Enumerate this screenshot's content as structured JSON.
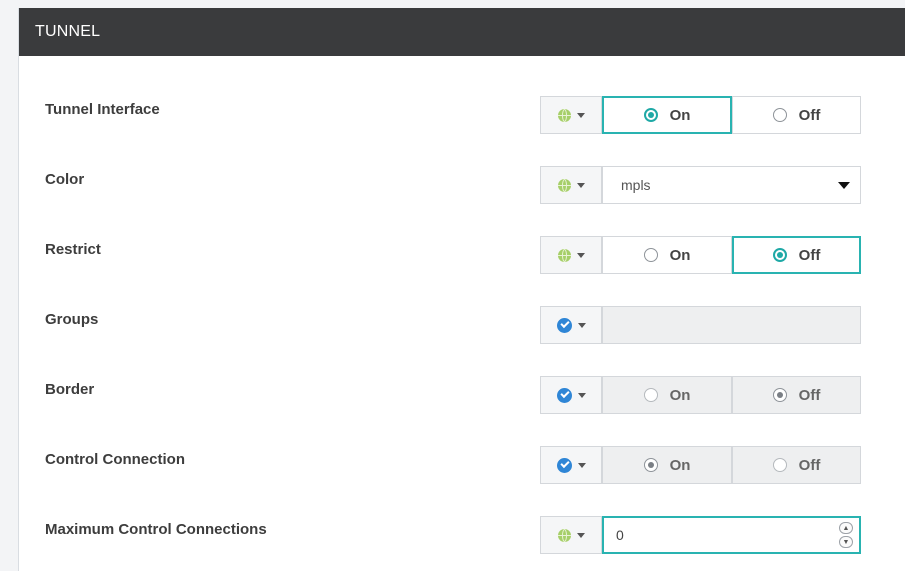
{
  "section": {
    "title": "TUNNEL"
  },
  "fields": {
    "tunnel_interface": {
      "label": "Tunnel Interface",
      "scope_icon": "globe-icon",
      "on_label": "On",
      "off_label": "Off",
      "selected": "On"
    },
    "color": {
      "label": "Color",
      "scope_icon": "globe-icon",
      "value": "mpls"
    },
    "restrict": {
      "label": "Restrict",
      "scope_icon": "globe-icon",
      "on_label": "On",
      "off_label": "Off",
      "selected": "Off"
    },
    "groups": {
      "label": "Groups",
      "scope_icon": "check-icon",
      "value": ""
    },
    "border": {
      "label": "Border",
      "scope_icon": "check-icon",
      "on_label": "On",
      "off_label": "Off",
      "selected": "Off"
    },
    "control_connection": {
      "label": "Control Connection",
      "scope_icon": "check-icon",
      "on_label": "On",
      "off_label": "Off",
      "selected": "On"
    },
    "max_control_connections": {
      "label": "Maximum Control Connections",
      "scope_icon": "globe-icon",
      "value": "0"
    }
  },
  "colors": {
    "header_bg": "#3a3b3d",
    "accent_teal": "#29b3b1",
    "globe_green": "#a6cf68",
    "check_blue": "#2f86d6"
  }
}
